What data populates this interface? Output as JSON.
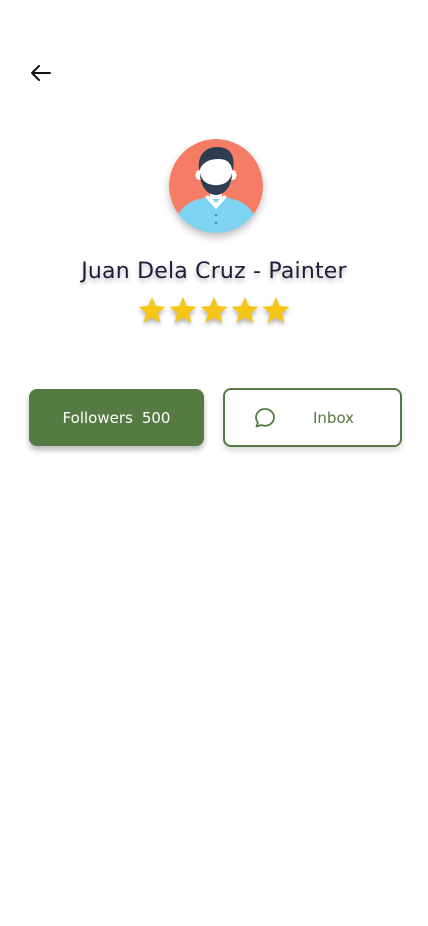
{
  "header": {
    "back_icon": "arrow-left-icon"
  },
  "profile": {
    "avatar_icon": "user-avatar-icon",
    "name": "Juan Dela Cruz - Painter",
    "rating": 5,
    "rating_max": 5,
    "star_color": "#f5c518"
  },
  "actions": {
    "followers_label": "Followers",
    "followers_count": "500",
    "inbox_label": "Inbox",
    "inbox_icon": "chat-bubble-icon"
  },
  "colors": {
    "accent": "#557b43",
    "avatar_background": "#f57c65",
    "shirt": "#7dd3f0",
    "hair": "#2f3d52"
  }
}
